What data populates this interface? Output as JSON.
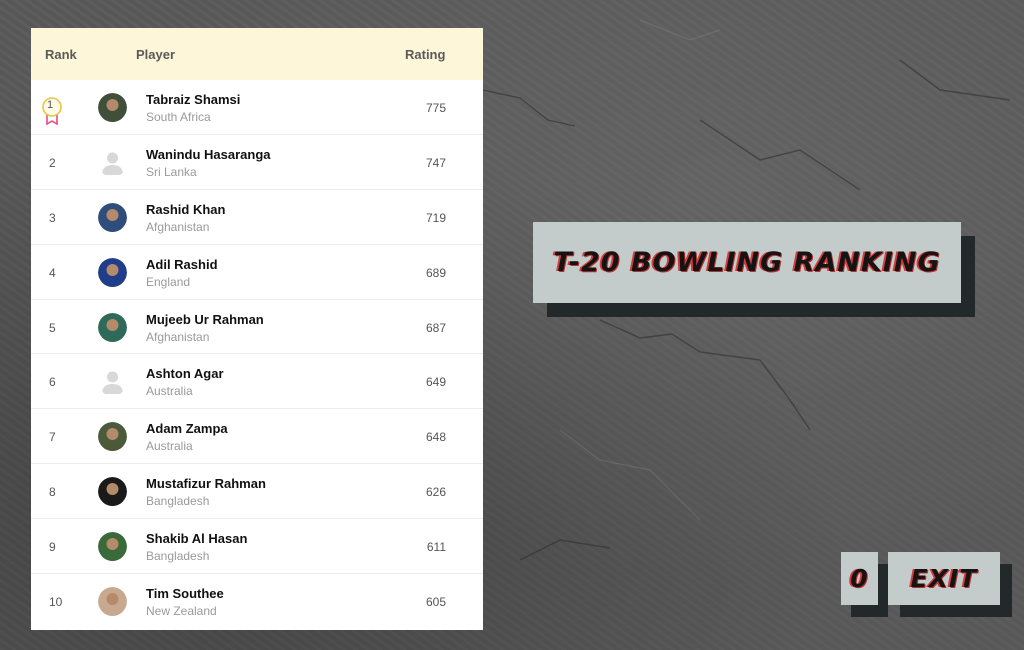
{
  "table": {
    "headers": {
      "rank": "Rank",
      "player": "Player",
      "rating": "Rating"
    },
    "rows": [
      {
        "rank": "1",
        "name": "Tabraiz Shamsi",
        "country": "South Africa",
        "rating": "775",
        "avatar": "photo",
        "avatar_color": "#3f4f3a"
      },
      {
        "rank": "2",
        "name": "Wanindu Hasaranga",
        "country": "Sri Lanka",
        "rating": "747",
        "avatar": "placeholder",
        "avatar_color": "#d6d6d6"
      },
      {
        "rank": "3",
        "name": "Rashid Khan",
        "country": "Afghanistan",
        "rating": "719",
        "avatar": "photo",
        "avatar_color": "#2f4d7a"
      },
      {
        "rank": "4",
        "name": "Adil Rashid",
        "country": "England",
        "rating": "689",
        "avatar": "photo",
        "avatar_color": "#1f3d8a"
      },
      {
        "rank": "5",
        "name": "Mujeeb Ur Rahman",
        "country": "Afghanistan",
        "rating": "687",
        "avatar": "photo",
        "avatar_color": "#2e6a5a"
      },
      {
        "rank": "6",
        "name": "Ashton Agar",
        "country": "Australia",
        "rating": "649",
        "avatar": "placeholder",
        "avatar_color": "#d6d6d6"
      },
      {
        "rank": "7",
        "name": "Adam Zampa",
        "country": "Australia",
        "rating": "648",
        "avatar": "photo",
        "avatar_color": "#4a5a3a"
      },
      {
        "rank": "8",
        "name": "Mustafizur Rahman",
        "country": "Bangladesh",
        "rating": "626",
        "avatar": "photo",
        "avatar_color": "#1a1a1a"
      },
      {
        "rank": "9",
        "name": "Shakib Al Hasan",
        "country": "Bangladesh",
        "rating": "611",
        "avatar": "photo",
        "avatar_color": "#3a6a3a"
      },
      {
        "rank": "10",
        "name": "Tim Southee",
        "country": "New Zealand",
        "rating": "605",
        "avatar": "photo",
        "avatar_color": "#c9a890"
      }
    ]
  },
  "title": "T-20 BOWLING RANKING",
  "score": "0",
  "exit_label": "EXIT",
  "colors": {
    "header_bg": "#fdf6d8",
    "panel_bg": "#c3ccca",
    "shadow": "#23292a",
    "accent_red": "#d63b3b"
  }
}
